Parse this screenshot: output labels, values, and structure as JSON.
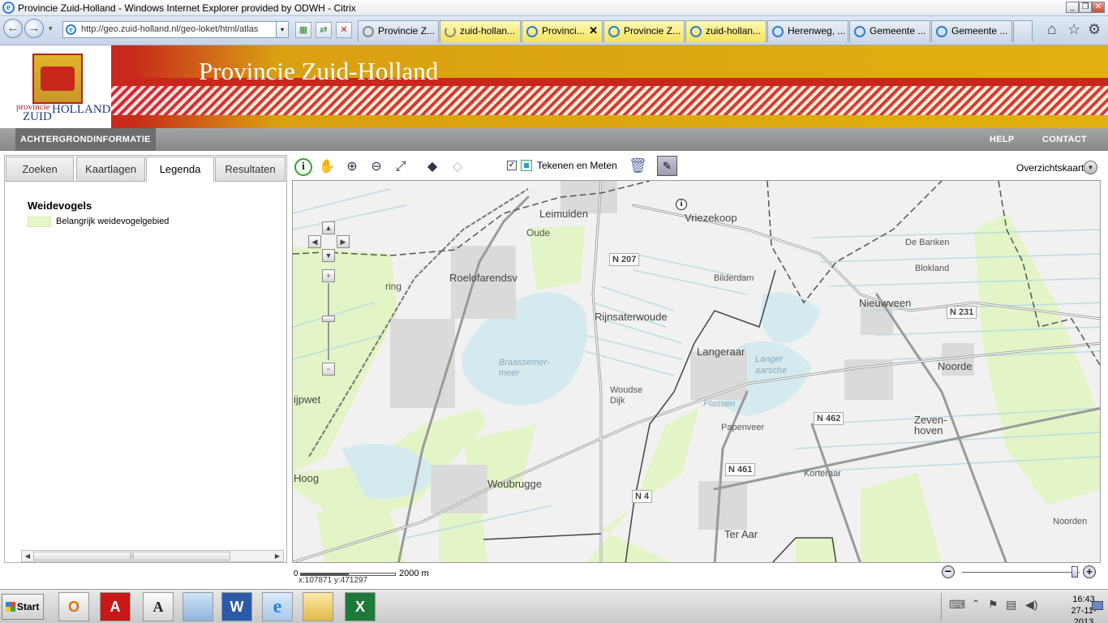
{
  "window": {
    "title": "Provincie Zuid-Holland - Windows Internet Explorer provided by ODWH - Citrix",
    "minimize": "_",
    "restore": "❐",
    "close": "✕"
  },
  "browser": {
    "back": "←",
    "forward": "→",
    "dropdown": "▾",
    "address": "http://geo.zuid-holland.nl/geo-loket/html/atlas",
    "tabs": [
      {
        "label": "Provincie Z..."
      },
      {
        "label": "zuid-hollan..."
      },
      {
        "label": "Provinci...",
        "close": "✕"
      },
      {
        "label": "Provincie Z..."
      },
      {
        "label": "zuid-hollan..."
      },
      {
        "label": "Herenweg, ..."
      },
      {
        "label": "Gemeente ..."
      },
      {
        "label": "Gemeente ..."
      }
    ],
    "home": "⌂",
    "favorites": "☆",
    "tools": "⚙"
  },
  "header": {
    "title": "Provincie Zuid-Holland",
    "logo_provincie": "provincie",
    "logo_zuid": "ZUID",
    "logo_holland": "HOLLAND"
  },
  "nav": {
    "left": "ACHTERGRONDINFORMATIE",
    "help": "HELP",
    "contact": "CONTACT"
  },
  "panel": {
    "tabs": [
      "Zoeken",
      "Kaartlagen",
      "Legenda",
      "Resultaten"
    ],
    "selected_tab": "Legenda",
    "legend_title": "Weidevogels",
    "legend_item": "Belangrijk weidevogelgebied",
    "legend_color": "#e6f6c8",
    "scroll_left": "◀",
    "scroll_right": "▶",
    "scroll_grip": "|||"
  },
  "toolbar": {
    "info": "i",
    "checkbox": "✓",
    "tekenen_label": "Tekenen en Meten",
    "overzicht_label": "Overzichtskaart",
    "overzicht_arrow": "▼"
  },
  "map": {
    "pan_up": "▲",
    "pan_down": "▼",
    "pan_left": "◀",
    "pan_right": "▶",
    "zoom_in": "+",
    "zoom_out": "−",
    "places": {
      "leimuiden": "Leimuiden",
      "oude": "Oude",
      "vriezekoop": "Vriezekoop",
      "roelofarendsv": "Roelofarendsv",
      "ring": "ring",
      "bilderdam": "Bilderdam",
      "de_banken": "De Banken",
      "blokland": "Blokland",
      "nieuwveen": "Nieuwveen",
      "rijnsaterwoude": "Rijnsaterwoude",
      "langeraar": "Langeraar",
      "noorde": "Noorde",
      "woudse": "Woudse",
      "dijk": "Dijk",
      "ijpwet": "ijpwet",
      "papenveer": "Papenveer",
      "zeven": "Zeven-",
      "hoven": "hoven",
      "hoog": "Hoog",
      "woubrugge": "Woubrugge",
      "korteraar": "Korteraar",
      "ter_aar": "Ter Aar",
      "noorden": "Noorden"
    },
    "water": {
      "braassem1": "Braassemer-",
      "braassem2": "meer",
      "langer1": "Langer",
      "langer2": "aarsche",
      "plassen": "Plassen"
    },
    "roads": {
      "n207": "N 207",
      "n231": "N 231",
      "n462": "N 462",
      "n461": "N 461",
      "n4": "N 4"
    }
  },
  "scale": {
    "zero": "0",
    "label": "2000 m",
    "coords": "x:107871   y:471297"
  },
  "taskbar": {
    "start": "Start",
    "apps": [
      "O",
      "A",
      "A",
      "",
      "W",
      "e",
      "",
      "X"
    ],
    "time": "16:43",
    "date": "27-11-2013"
  }
}
